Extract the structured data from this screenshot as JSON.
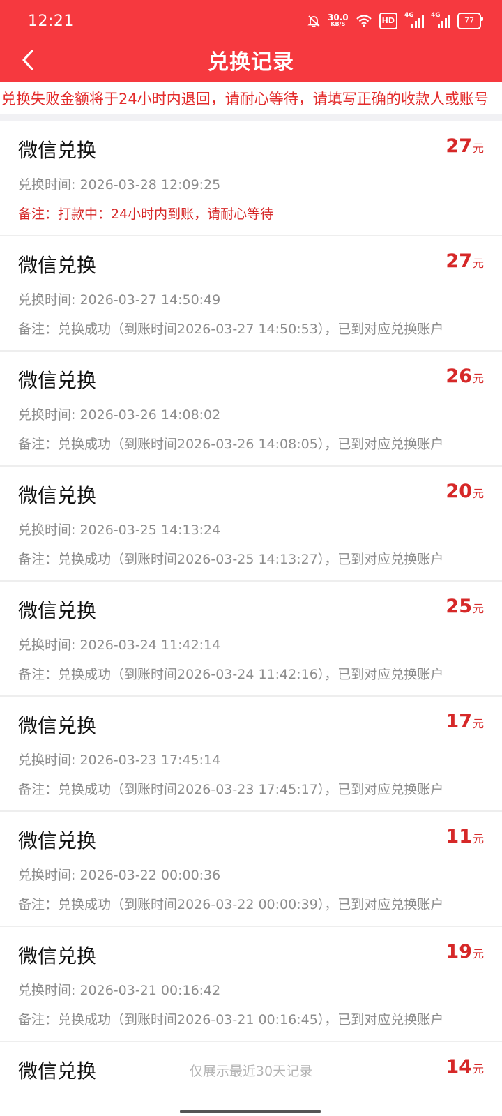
{
  "status_bar": {
    "time": "12:21",
    "net_speed_value": "30.0",
    "net_speed_unit": "KB/S",
    "hd_label": "HD",
    "sim1_label": "4G",
    "sim2_label": "4G",
    "battery": "77",
    "icons": [
      "mute-bell-icon",
      "wifi-icon",
      "signal-icon",
      "battery-icon"
    ]
  },
  "nav": {
    "title": "兑换记录",
    "back_icon": "chevron-left-icon"
  },
  "notice": "兑换失败金额将于24小时内退回，请耐心等待，请填写正确的收款人或账号",
  "records": [
    {
      "name": "微信兑换",
      "amount": "27",
      "unit": "元",
      "time": "兑换时间: 2026-03-28 12:09:25",
      "note": "备注：打款中：24小时内到账，请耐心等待",
      "note_highlight": true
    },
    {
      "name": "微信兑换",
      "amount": "27",
      "unit": "元",
      "time": "兑换时间: 2026-03-27 14:50:49",
      "note": "备注：兑换成功（到账时间2026-03-27 14:50:53），已到对应兑换账户",
      "note_highlight": false
    },
    {
      "name": "微信兑换",
      "amount": "26",
      "unit": "元",
      "time": "兑换时间: 2026-03-26 14:08:02",
      "note": "备注：兑换成功（到账时间2026-03-26 14:08:05），已到对应兑换账户",
      "note_highlight": false
    },
    {
      "name": "微信兑换",
      "amount": "20",
      "unit": "元",
      "time": "兑换时间: 2026-03-25 14:13:24",
      "note": "备注：兑换成功（到账时间2026-03-25 14:13:27），已到对应兑换账户",
      "note_highlight": false
    },
    {
      "name": "微信兑换",
      "amount": "25",
      "unit": "元",
      "time": "兑换时间: 2026-03-24 11:42:14",
      "note": "备注：兑换成功（到账时间2026-03-24 11:42:16），已到对应兑换账户",
      "note_highlight": false
    },
    {
      "name": "微信兑换",
      "amount": "17",
      "unit": "元",
      "time": "兑换时间: 2026-03-23 17:45:14",
      "note": "备注：兑换成功（到账时间2026-03-23 17:45:17），已到对应兑换账户",
      "note_highlight": false
    },
    {
      "name": "微信兑换",
      "amount": "11",
      "unit": "元",
      "time": "兑换时间: 2026-03-22 00:00:36",
      "note": "备注：兑换成功（到账时间2026-03-22 00:00:39），已到对应兑换账户",
      "note_highlight": false
    },
    {
      "name": "微信兑换",
      "amount": "19",
      "unit": "元",
      "time": "兑换时间: 2026-03-21 00:16:42",
      "note": "备注：兑换成功（到账时间2026-03-21 00:16:45），已到对应兑换账户",
      "note_highlight": false
    },
    {
      "name": "微信兑换",
      "amount": "14",
      "unit": "元",
      "time": "",
      "note": "",
      "note_highlight": false
    }
  ],
  "footer_tip": "仅展示最近30天记录",
  "colors": {
    "header_red": "#f6393f",
    "accent_red": "#d62828",
    "muted_text": "#8d8d8d"
  }
}
